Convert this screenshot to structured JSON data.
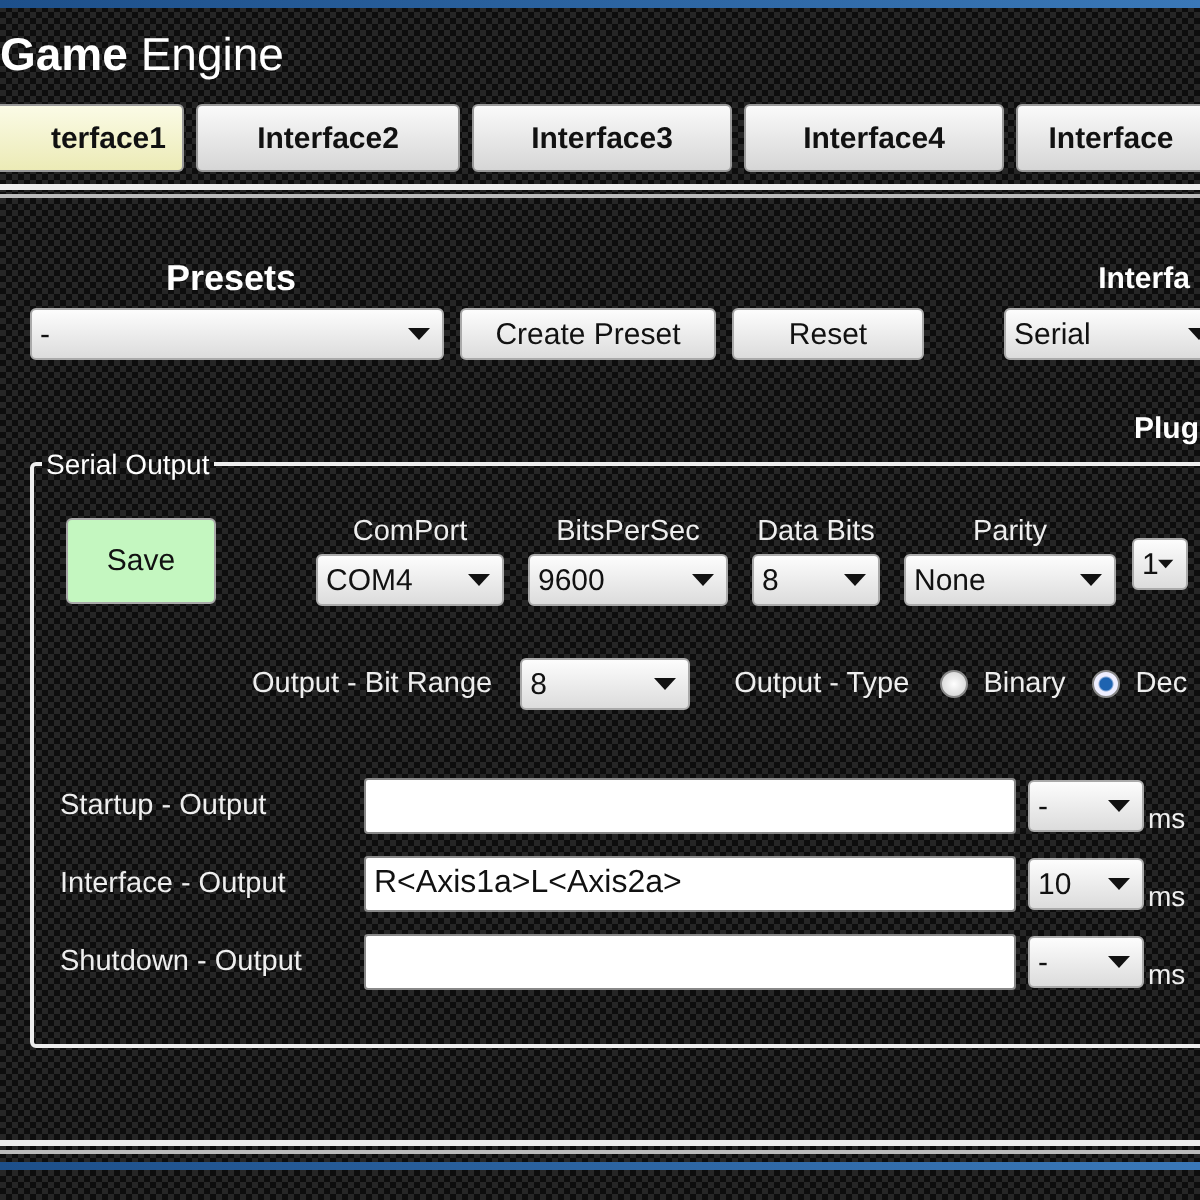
{
  "window": {
    "title": "**Game** Engine"
  },
  "tabs": [
    {
      "label": "terface1",
      "selected": true
    },
    {
      "label": "Interface2",
      "selected": false
    },
    {
      "label": "Interface3",
      "selected": false
    },
    {
      "label": "Interface4",
      "selected": false
    },
    {
      "label": "Interface",
      "selected": false
    }
  ],
  "presets": {
    "heading": "Presets",
    "value": "-",
    "buttons": [
      "Create Preset",
      "Reset"
    ]
  },
  "interface": {
    "heading": "Interfa",
    "value": "Serial"
  },
  "plugin_label": "Plug",
  "serial_output": {
    "legend": "Serial Output",
    "save": "Save",
    "settings": [
      {
        "label": "ComPort",
        "value": "COM4"
      },
      {
        "label": "BitsPerSec",
        "value": "9600"
      },
      {
        "label": "Data Bits",
        "value": "8"
      },
      {
        "label": "Parity",
        "value": "None"
      },
      {
        "value": "1"
      }
    ],
    "bit_range": {
      "label": "Output - Bit Range",
      "value": "8"
    },
    "output_type": {
      "label": "Output - Type",
      "options": [
        {
          "label": "Binary",
          "selected": false
        },
        {
          "label": "Dec",
          "selected": true
        }
      ]
    },
    "outputs": [
      {
        "label": "Startup - Output",
        "delay": "-",
        "unit": "ms"
      },
      {
        "label": "Interface - Output",
        "value": "R<Axis1a>L<Axis2a>",
        "delay": "10",
        "unit": "ms"
      },
      {
        "label": "Shutdown - Output",
        "delay": "-",
        "unit": "ms"
      }
    ]
  }
}
